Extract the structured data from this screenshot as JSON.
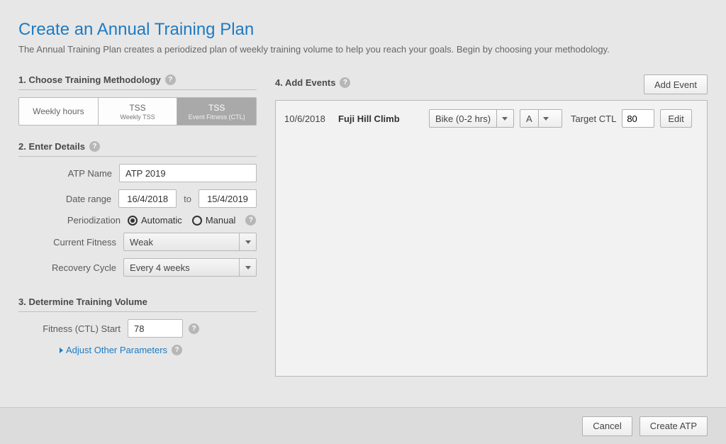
{
  "page": {
    "title": "Create an Annual Training Plan",
    "subtitle": "The Annual Training Plan creates a periodized plan of weekly training volume to help you reach your goals. Begin by choosing your methodology."
  },
  "sections": {
    "methodology": "1. Choose Training Methodology",
    "details": "2. Enter Details",
    "volume": "3. Determine Training Volume",
    "events": "4. Add Events"
  },
  "method_tabs": [
    {
      "label": "Weekly hours",
      "sub": ""
    },
    {
      "label": "TSS",
      "sub": "Weekly TSS"
    },
    {
      "label": "TSS",
      "sub": "Event Fitness (CTL)"
    }
  ],
  "details": {
    "atp_name_label": "ATP Name",
    "atp_name_value": "ATP 2019",
    "date_range_label": "Date range",
    "date_from": "16/4/2018",
    "date_to_label": "to",
    "date_to": "15/4/2019",
    "periodization_label": "Periodization",
    "periodization_auto": "Automatic",
    "periodization_manual": "Manual",
    "current_fitness_label": "Current Fitness",
    "current_fitness_value": "Weak",
    "recovery_cycle_label": "Recovery Cycle",
    "recovery_cycle_value": "Every 4 weeks"
  },
  "volume": {
    "ctl_start_label": "Fitness (CTL) Start",
    "ctl_start_value": "78",
    "adjust_link": "Adjust Other Parameters"
  },
  "events": {
    "add_button": "Add Event",
    "row": {
      "date": "10/6/2018",
      "name": "Fuji Hill Climb",
      "type": "Bike (0-2 hrs)",
      "priority": "A",
      "target_label": "Target CTL",
      "target_value": "80",
      "edit": "Edit"
    }
  },
  "footer": {
    "cancel": "Cancel",
    "create": "Create ATP"
  }
}
